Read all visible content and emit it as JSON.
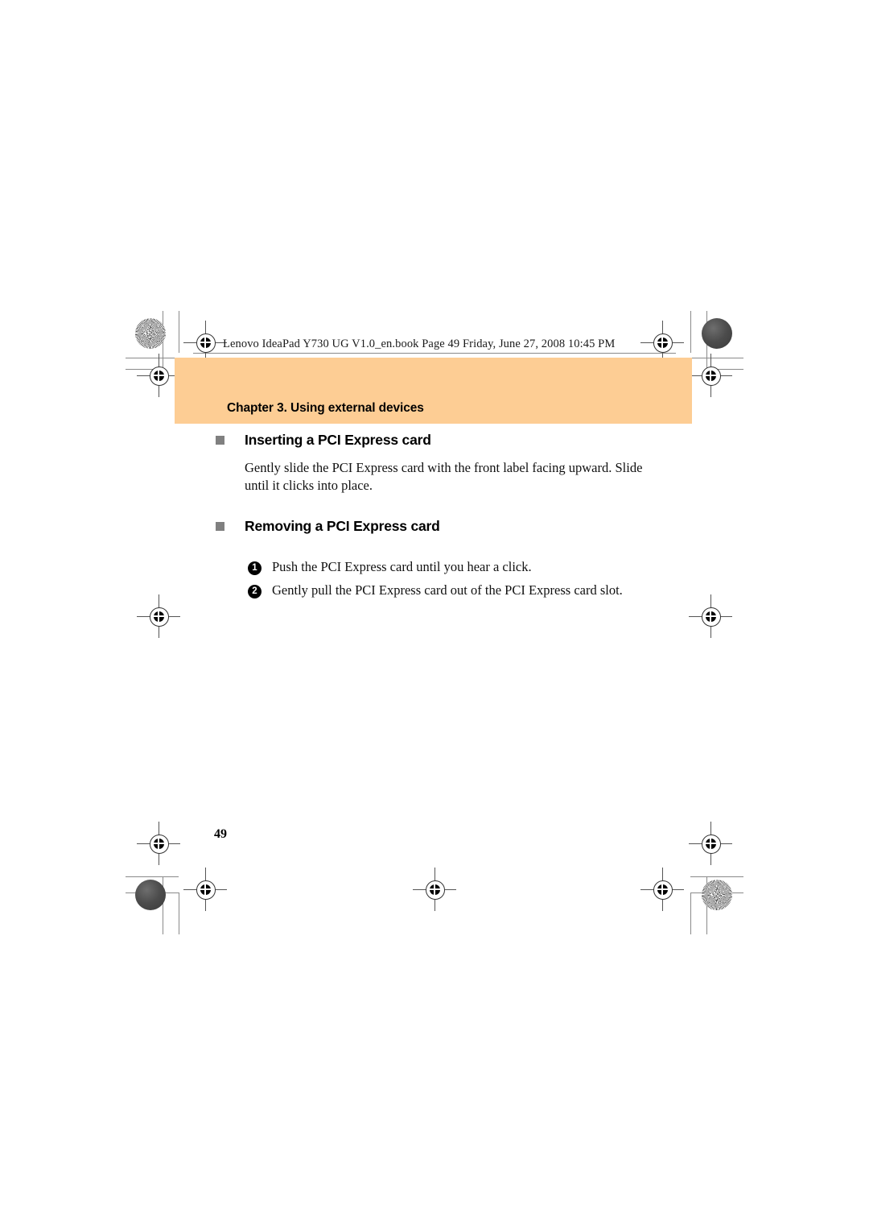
{
  "document": {
    "book_header": "Lenovo IdeaPad Y730 UG V1.0_en.book  Page 49  Friday, June 27, 2008  10:45 PM",
    "chapter_title": "Chapter 3. Using external devices",
    "page_number": "49",
    "band_color": "#fdcd94",
    "bullet_color": "#808080"
  },
  "sections": [
    {
      "title": "Inserting a PCI Express card",
      "paragraph": "Gently slide the PCI Express card with the front label facing upward. Slide until it clicks into place."
    },
    {
      "title": "Removing a PCI Express card",
      "steps": [
        {
          "num": "1",
          "text": "Push the PCI Express card until you hear a click."
        },
        {
          "num": "2",
          "text": "Gently pull the PCI Express card out of the PCI Express card slot."
        }
      ]
    }
  ]
}
